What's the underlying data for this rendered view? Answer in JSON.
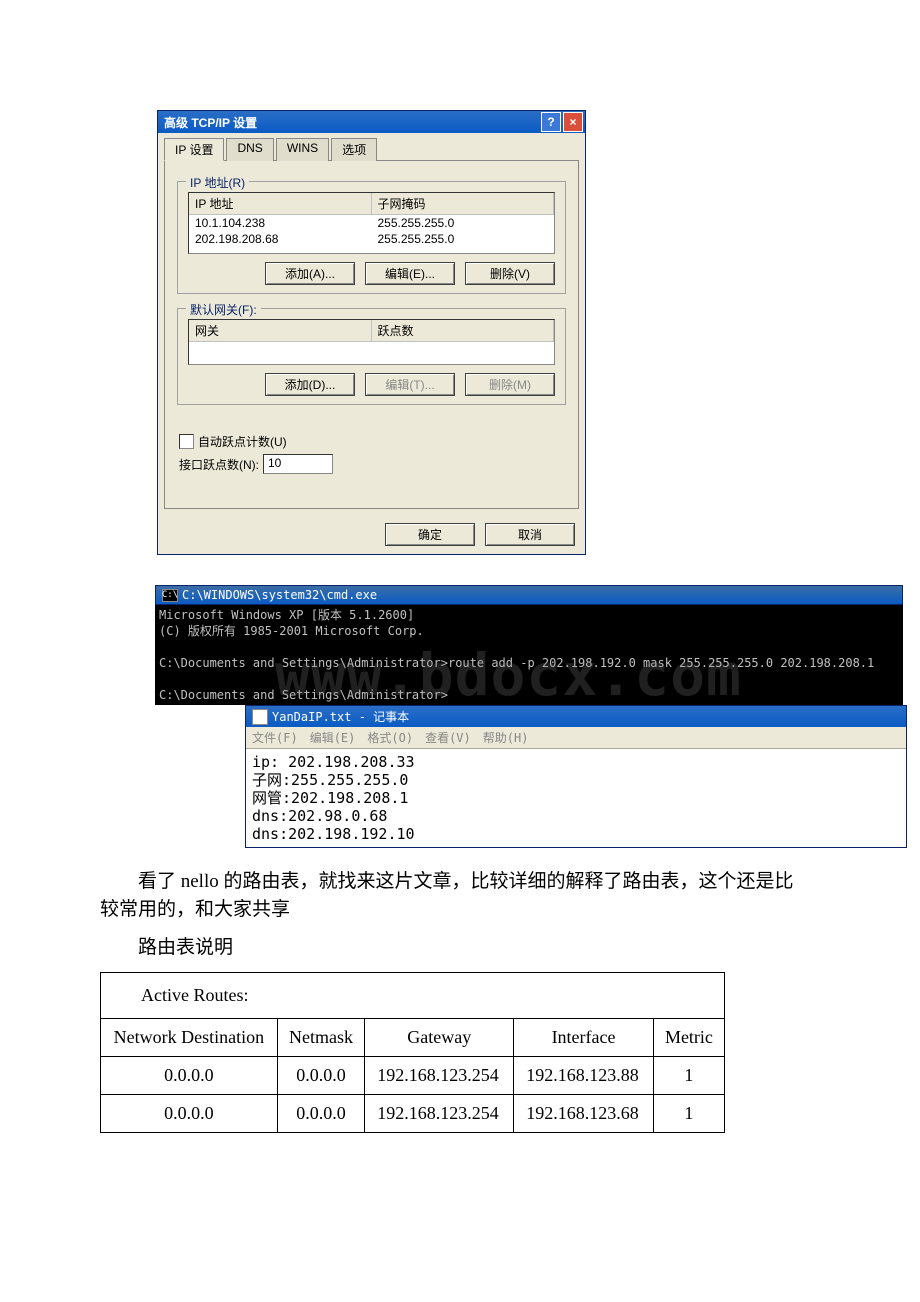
{
  "dialog": {
    "title": "高级  TCP/IP 设置",
    "tabs": {
      "ip_settings": "IP 设置",
      "dns": "DNS",
      "wins": "WINS",
      "options": "选项"
    },
    "group_ip": {
      "legend": "IP 地址(R)",
      "col_ip": "IP 地址",
      "col_mask": "子网掩码",
      "rows": [
        {
          "ip": "10.1.104.238",
          "mask": "255.255.255.0"
        },
        {
          "ip": "202.198.208.68",
          "mask": "255.255.255.0"
        }
      ],
      "btn_add": "添加(A)...",
      "btn_edit": "编辑(E)...",
      "btn_del": "删除(V)"
    },
    "group_gw": {
      "legend": "默认网关(F):",
      "col_gw": "网关",
      "col_metric": "跃点数",
      "btn_add": "添加(D)...",
      "btn_edit": "编辑(T)...",
      "btn_del": "删除(M)"
    },
    "auto_metric_label": "自动跃点计数(U)",
    "iface_metric_label": "接口跃点数(N):",
    "iface_metric_value": "10",
    "btn_ok": "确定",
    "btn_cancel": "取消"
  },
  "cmd": {
    "title_path": "C:\\WINDOWS\\system32\\cmd.exe",
    "line1": "Microsoft Windows XP [版本 5.1.2600]",
    "line2": "(C) 版权所有 1985-2001 Microsoft Corp.",
    "line3": "C:\\Documents and Settings\\Administrator>route add -p 202.198.192.0 mask 255.255.255.0 202.198.208.1",
    "line4": "C:\\Documents and Settings\\Administrator>",
    "watermark": "www.bdocx.com"
  },
  "notepad": {
    "title": "YanDaIP.txt - 记事本",
    "menu": {
      "file": "文件(F)",
      "edit": "编辑(E)",
      "format": "格式(O)",
      "view": "查看(V)",
      "help": "帮助(H)"
    },
    "lines": {
      "l1": "ip: 202.198.208.33",
      "l2": "子网:255.255.255.0",
      "l3": "网管:202.198.208.1",
      "l4": "dns:202.98.0.68",
      "l5": "dns:202.198.192.10"
    }
  },
  "article": {
    "p1": "看了 nello 的路由表，就找来这片文章，比较详细的解释了路由表，这个还是比较常用的，和大家共享",
    "p2": "路由表说明"
  },
  "route_table": {
    "header": "Active Routes:",
    "cols": {
      "dest": "Network Destination",
      "mask": "Netmask",
      "gw": "Gateway",
      "iface": "Interface",
      "metric": "Metric"
    },
    "rows": [
      {
        "dest": "0.0.0.0",
        "mask": "0.0.0.0",
        "gw": "192.168.123.254",
        "iface": "192.168.123.88",
        "metric": "1"
      },
      {
        "dest": "0.0.0.0",
        "mask": "0.0.0.0",
        "gw": "192.168.123.254",
        "iface": "192.168.123.68",
        "metric": "1"
      }
    ]
  }
}
